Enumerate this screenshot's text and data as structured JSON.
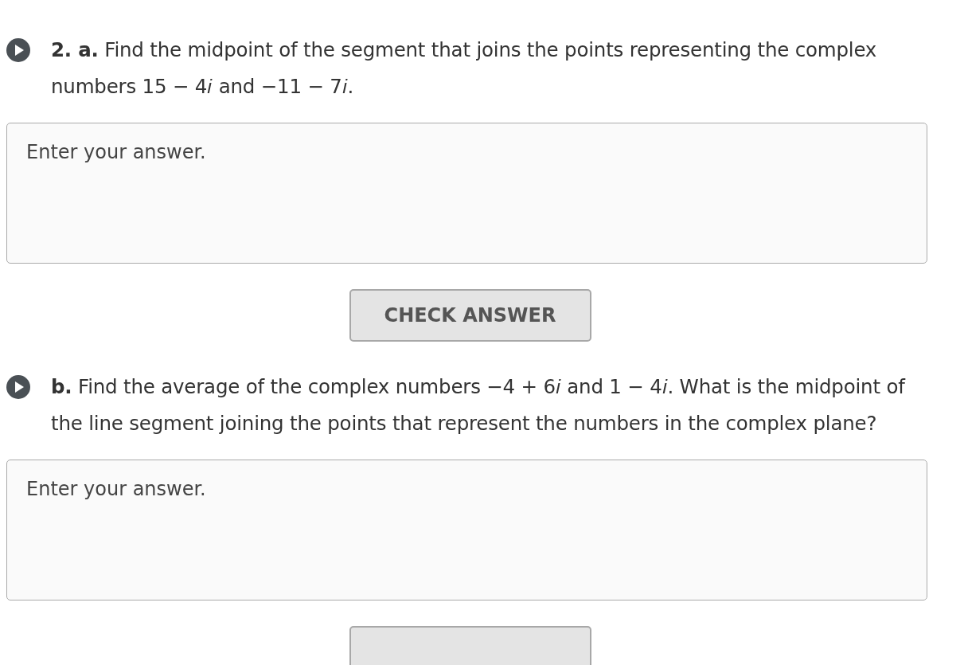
{
  "questions": [
    {
      "text": "**2. a.** Find the midpoint of the segment that joins the points representing the complex numbers 15 − 4𝑖 and −11 − 7𝑖.",
      "answer": {
        "placeholder": "Enter your answer."
      },
      "button": {
        "kind": "full",
        "label": "CHECK ANSWER"
      }
    },
    {
      "text": "**b.** Find the average of the complex numbers −4 + 6𝑖 and 1 − 4𝑖. What is the midpoint of the line segment joining the points that represent the numbers in the complex plane?",
      "answer": {
        "placeholder": "Enter your answer."
      },
      "button": {
        "kind": "cut"
      }
    }
  ]
}
